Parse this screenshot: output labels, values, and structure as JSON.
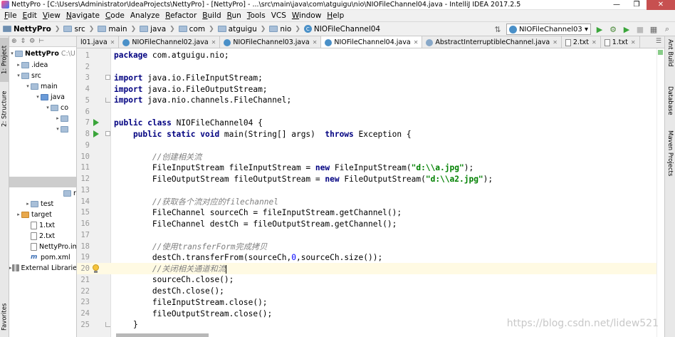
{
  "window": {
    "title": "NettyPro - [C:\\Users\\Administrator\\IdeaProjects\\NettyPro] - [NettyPro] - ...\\src\\main\\java\\com\\atguigu\\nio\\NIOFileChannel04.java - IntelliJ IDEA 2017.2.5",
    "minimize": "—",
    "maximize": "❐",
    "close": "✕"
  },
  "menu": [
    {
      "mnemonic": "F",
      "rest": "ile"
    },
    {
      "mnemonic": "E",
      "rest": "dit"
    },
    {
      "mnemonic": "V",
      "rest": "iew"
    },
    {
      "mnemonic": "N",
      "rest": "avigate"
    },
    {
      "mnemonic": "C",
      "rest": "ode"
    },
    {
      "mnemonic": "",
      "rest": "Analyze"
    },
    {
      "mnemonic": "R",
      "rest": "efactor"
    },
    {
      "mnemonic": "B",
      "rest": "uild"
    },
    {
      "mnemonic": "R",
      "rest": "un"
    },
    {
      "mnemonic": "T",
      "rest": "ools"
    },
    {
      "mnemonic": "",
      "rest": "VCS"
    },
    {
      "mnemonic": "W",
      "rest": "indow"
    },
    {
      "mnemonic": "H",
      "rest": "elp"
    }
  ],
  "breadcrumb": [
    "NettyPro",
    "src",
    "main",
    "java",
    "com",
    "atguigu",
    "nio",
    "NIOFileChannel04"
  ],
  "run_config": {
    "label": "NIOFileChannel03",
    "dropdown": "▾",
    "run": "▶",
    "debug": "⚙",
    "stop": "■"
  },
  "left_tools": {
    "project": "1: Project",
    "structure": "2: Structure",
    "favorites": "Favorites"
  },
  "right_tools": {
    "ant": "Ant Build",
    "database": "Database",
    "maven": "Maven Projects"
  },
  "project_tree": {
    "root": "NettyPro",
    "root_path": "C:\\U",
    "items": [
      {
        "label": ".idea"
      },
      {
        "label": "src"
      },
      {
        "label": "main"
      },
      {
        "label": "java"
      },
      {
        "label": "co"
      },
      {
        "label": "resou"
      },
      {
        "label": "test"
      },
      {
        "label": "target"
      },
      {
        "label": "1.txt"
      },
      {
        "label": "2.txt"
      },
      {
        "label": "NettyPro.im"
      },
      {
        "label": "pom.xml"
      },
      {
        "label": "External Librarie"
      }
    ]
  },
  "tabs": [
    {
      "label": "l01.java"
    },
    {
      "label": "NIOFileChannel02.java"
    },
    {
      "label": "NIOFileChannel03.java"
    },
    {
      "label": "NIOFileChannel04.java"
    },
    {
      "label": "AbstractInterruptibleChannel.java"
    },
    {
      "label": "2.txt"
    },
    {
      "label": "1.txt"
    }
  ],
  "tab_overflow": "☰",
  "code": {
    "line_numbers": [
      "1",
      "2",
      "3",
      "4",
      "5",
      "6",
      "7",
      "8",
      "9",
      "10",
      "11",
      "12",
      "13",
      "14",
      "15",
      "16",
      "17",
      "18",
      "19",
      "20",
      "21",
      "22",
      "23",
      "24",
      "25"
    ],
    "l1a": "package",
    "l1b": " com.atguigu.nio;",
    "l3a": "import",
    "l3b": " java.io.FileInputStream;",
    "l4a": "import",
    "l4b": " java.io.FileOutputStream;",
    "l5a": "import",
    "l5b": " java.nio.channels.FileChannel;",
    "l7a": "public class",
    "l7b": " NIOFileChannel04 {",
    "l8a": "    public static void",
    "l8b": " main(String[] args)  ",
    "l8c": "throws",
    "l8d": " Exception {",
    "l10": "        //创建相关流",
    "l11a": "        FileInputStream fileInputStream = ",
    "l11b": "new",
    "l11c": " FileInputStream(",
    "l11d": "\"d:\\\\a.jpg\"",
    "l11e": ");",
    "l12a": "        FileOutputStream fileOutputStream = ",
    "l12b": "new",
    "l12c": " FileOutputStream(",
    "l12d": "\"d:\\\\a2.jpg\"",
    "l12e": ");",
    "l14": "        //获取各个流对应的filechannel",
    "l15": "        FileChannel sourceCh = fileInputStream.getChannel();",
    "l16": "        FileChannel destCh = fileOutputStream.getChannel();",
    "l18": "        //使用transferForm完成拷贝",
    "l19a": "        destCh.transferFrom(sourceCh,",
    "l19b": "0",
    "l19c": ",sourceCh.size());",
    "l20": "        //关闭相关通道和流",
    "l21": "        sourceCh.close();",
    "l22": "        destCh.close();",
    "l23": "        fileInputStream.close();",
    "l24": "        fileOutputStream.close();",
    "l25": "    }"
  },
  "watermark": "https://blog.csdn.net/lidew521",
  "colors": {
    "keyword": "#000080",
    "string": "#008000",
    "comment": "#808080",
    "number": "#0000ff",
    "current_line": "#fffae3"
  }
}
